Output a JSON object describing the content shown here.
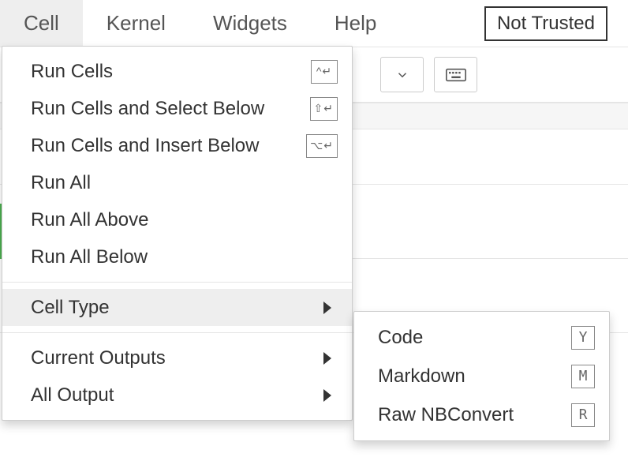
{
  "menubar": {
    "items": [
      {
        "label": "Cell",
        "active": true
      },
      {
        "label": "Kernel",
        "active": false
      },
      {
        "label": "Widgets",
        "active": false
      },
      {
        "label": "Help",
        "active": false
      }
    ],
    "not_trusted_label": "Not Trusted"
  },
  "toolbar": {
    "dropdown_icon": "chevron-down",
    "keyboard_icon": "keyboard"
  },
  "cell_menu": {
    "items": [
      {
        "label": "Run Cells",
        "shortcut_glyph": "^↵",
        "has_submenu": false
      },
      {
        "label": "Run Cells and Select Below",
        "shortcut_glyph": "⇧↵",
        "has_submenu": false
      },
      {
        "label": "Run Cells and Insert Below",
        "shortcut_glyph": "⌥↵",
        "has_submenu": false
      },
      {
        "label": "Run All",
        "shortcut_glyph": "",
        "has_submenu": false
      },
      {
        "label": "Run All Above",
        "shortcut_glyph": "",
        "has_submenu": false
      },
      {
        "label": "Run All Below",
        "shortcut_glyph": "",
        "has_submenu": false
      }
    ],
    "cell_type_label": "Cell Type",
    "current_outputs_label": "Current Outputs",
    "all_output_label": "All Output"
  },
  "cell_type_submenu": {
    "items": [
      {
        "label": "Code",
        "key": "Y"
      },
      {
        "label": "Markdown",
        "key": "M"
      },
      {
        "label": "Raw NBConvert",
        "key": "R"
      }
    ]
  },
  "colors": {
    "menu_active_bg": "#eeeeee",
    "border": "#e5e5e5",
    "cell_active_green": "#4caf50"
  }
}
